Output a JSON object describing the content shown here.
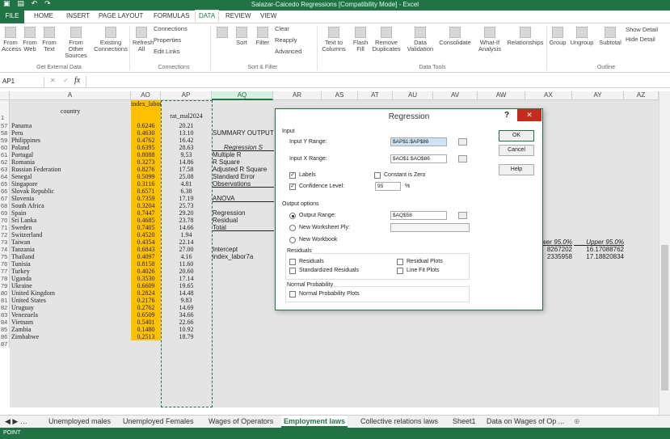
{
  "title": "Salazar-Caicedo Regressions  [Compatibility Mode] - Excel",
  "tabs": [
    "FILE",
    "HOME",
    "INSERT",
    "PAGE LAYOUT",
    "FORMULAS",
    "DATA",
    "REVIEW",
    "VIEW"
  ],
  "active_tab": "DATA",
  "ribbon": {
    "from_access": "From Access",
    "from_web": "From Web",
    "from_text": "From Text",
    "from_other": "From Other Sources",
    "existing": "Existing Connections",
    "refresh": "Refresh All",
    "connections": "Connections",
    "properties": "Properties",
    "edit_links": "Edit Links",
    "sort": "Sort",
    "filter": "Filter",
    "clear": "Clear",
    "reapply": "Reapply",
    "advanced": "Advanced",
    "text_to_columns": "Text to Columns",
    "flash_fill": "Flash Fill",
    "remove_dup": "Remove Duplicates",
    "data_validation": "Data Validation",
    "consolidate": "Consolidate",
    "what_if": "What-If Analysis",
    "relationships": "Relationships",
    "group": "Group",
    "ungroup": "Ungroup",
    "subtotal": "Subtotal",
    "show_detail": "Show Detail",
    "hide_detail": "Hide Detail",
    "grp_external": "Get External Data",
    "grp_connections": "Connections",
    "grp_sort": "Sort & Filter",
    "grp_tools": "Data Tools",
    "grp_outline": "Outline"
  },
  "namebox": "AP1",
  "fx": "fx",
  "columns": [
    "A",
    "AO",
    "AP",
    "AQ",
    "AR",
    "AS",
    "AT",
    "AU",
    "AV",
    "AW",
    "AX",
    "AY",
    "AZ"
  ],
  "header_row": {
    "num": "1",
    "country": "country",
    "ao": "index_labor7a",
    "ap": "rat_mal2024"
  },
  "rows": [
    [
      "57",
      "Panama",
      "0.6246",
      "20.21"
    ],
    [
      "58",
      "Peru",
      "0.4630",
      "13.10"
    ],
    [
      "59",
      "Philippines",
      "0.4762",
      "16.42"
    ],
    [
      "60",
      "Poland",
      "0.6395",
      "28.63"
    ],
    [
      "61",
      "Portugal",
      "0.8088",
      "9.53"
    ],
    [
      "62",
      "Romania",
      "0.3273",
      "14.86"
    ],
    [
      "63",
      "Russian Federation",
      "0.8276",
      "17.58"
    ],
    [
      "64",
      "Senegal",
      "0.5099",
      "25.08"
    ],
    [
      "65",
      "Singapore",
      "0.3116",
      "4.81"
    ],
    [
      "66",
      "Slovak Republic",
      "0.6571",
      "6.38"
    ],
    [
      "67",
      "Slovenia",
      "0.7359",
      "17.19"
    ],
    [
      "68",
      "South Africa",
      "0.3204",
      "25.73"
    ],
    [
      "69",
      "Spain",
      "0.7447",
      "29.20"
    ],
    [
      "70",
      "Sri Lanka",
      "0.4685",
      "23.78"
    ],
    [
      "71",
      "Sweden",
      "0.7405",
      "14.66"
    ],
    [
      "72",
      "Switzerland",
      "0.4520",
      "1.94"
    ],
    [
      "73",
      "Taiwan",
      "0.4354",
      "22.14"
    ],
    [
      "74",
      "Tanzania",
      "0.6843",
      "27.00"
    ],
    [
      "75",
      "Thailand",
      "0.4097",
      "4.16"
    ],
    [
      "76",
      "Tunisia",
      "0.8158",
      "11.60"
    ],
    [
      "77",
      "Turkey",
      "0.4026",
      "20.60"
    ],
    [
      "78",
      "Uganda",
      "0.3530",
      "17.14"
    ],
    [
      "79",
      "Ukraine",
      "0.6609",
      "19.65"
    ],
    [
      "80",
      "United Kingdom",
      "0.2824",
      "14.48"
    ],
    [
      "81",
      "United States",
      "0.2176",
      "9.83"
    ],
    [
      "82",
      "Uruguay",
      "0.2762",
      "14.69"
    ],
    [
      "83",
      "Venezuela",
      "0.6509",
      "34.66"
    ],
    [
      "84",
      "Vietnam",
      "0.5401",
      "22.66"
    ],
    [
      "85",
      "Zambia",
      "0.1480",
      "10.92"
    ],
    [
      "86",
      "Zimbabwe",
      "0.2513",
      "18.79"
    ],
    [
      "87",
      "",
      "",
      " "
    ]
  ],
  "aq": {
    "r58": "SUMMARY OUTPUT",
    "r60": "Regression S",
    "r61": "Multiple R",
    "r62": "R Square",
    "r63": "Adjusted R Square",
    "r64": "Standard Error",
    "r65": "Observations",
    "r67": "ANOVA",
    "r69": "Regression",
    "r70": "Residual",
    "r71": "Total",
    "r74": "Intercept",
    "r75": "index_labor7a"
  },
  "right": {
    "l95": "Lower 95.0%",
    "u95": "Upper 95.0%",
    "ax74": "8267202",
    "ay74": "16.17088762",
    "ax75": "2335958",
    "ay75": "17.18820834"
  },
  "dialog": {
    "title": "Regression",
    "help_q": "?",
    "close": "✕",
    "input": "Input",
    "y_label": "Input Y Range:",
    "y_value": "$AP$1:$AP$86",
    "x_label": "Input X Range:",
    "x_value": "$AO$1:$AO$86",
    "labels": "Labels",
    "constant_zero": "Constant is Zero",
    "confidence": "Confidence Level:",
    "confidence_value": "95",
    "pct": "%",
    "output_options": "Output options",
    "output_range": "Output Range:",
    "output_value": "$AQ$58",
    "new_ply": "New Worksheet Ply:",
    "new_workbook": "New Workbook",
    "residuals_grp": "Residuals",
    "residuals": "Residuals",
    "std_residuals": "Standardized Residuals",
    "resid_plots": "Residual Plots",
    "fit_plots": "Line Fit Plots",
    "normal_grp": "Normal Probability",
    "normal_plots": "Normal Probability Plots",
    "ok": "OK",
    "cancel": "Cancel",
    "help": "Help"
  },
  "sheet_tabs": [
    "Unemployed males",
    "Unemployed Females",
    "Wages of Operators",
    "Employment laws",
    "Collective relations laws",
    "Sheet1",
    "Data on Wages of Op ..."
  ],
  "active_sheet": "Employment laws",
  "status": "POINT"
}
